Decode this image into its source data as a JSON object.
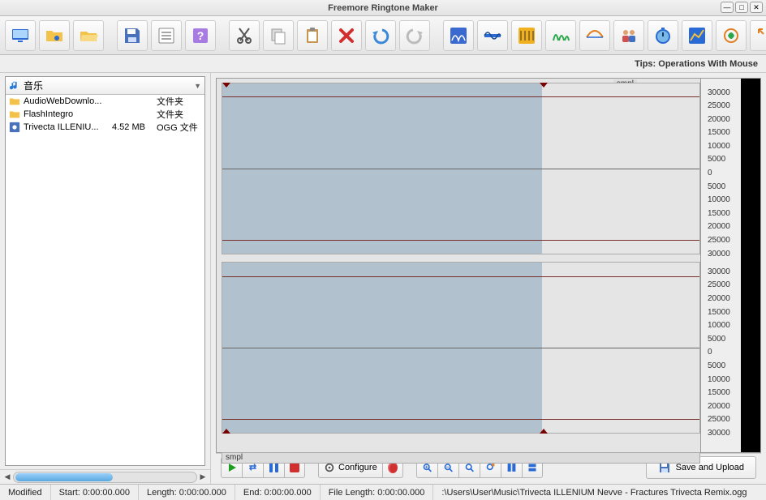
{
  "window": {
    "title": "Freemore Ringtone Maker"
  },
  "tips": {
    "text": "Tips: Operations With Mouse"
  },
  "sidebar": {
    "dropdown_label": "音乐",
    "items": [
      {
        "name": "AudioWebDownlo...",
        "size": "",
        "type": "文件夹"
      },
      {
        "name": "FlashIntegro",
        "size": "",
        "type": "文件夹"
      },
      {
        "name": "Trivecta ILLENIU...",
        "size": "4.52 MB",
        "type": "OGG 文件"
      }
    ]
  },
  "waveform": {
    "unit_label": "smpl",
    "ticks": [
      "30000",
      "25000",
      "20000",
      "15000",
      "10000",
      "5000",
      "0",
      "5000",
      "10000",
      "15000",
      "20000",
      "25000",
      "30000"
    ]
  },
  "transport": {
    "configure_label": "Configure",
    "save_label": "Save and Upload"
  },
  "status": {
    "modified": "Modified",
    "start": "Start: 0:00:00.000",
    "length": "Length: 0:00:00.000",
    "end": "End: 0:00:00.000",
    "file_length": "File Length: 0:00:00.000",
    "path": ":\\Users\\User\\Music\\Trivecta ILLENIUM Nevve - Fractures Trivecta Remix.ogg"
  }
}
